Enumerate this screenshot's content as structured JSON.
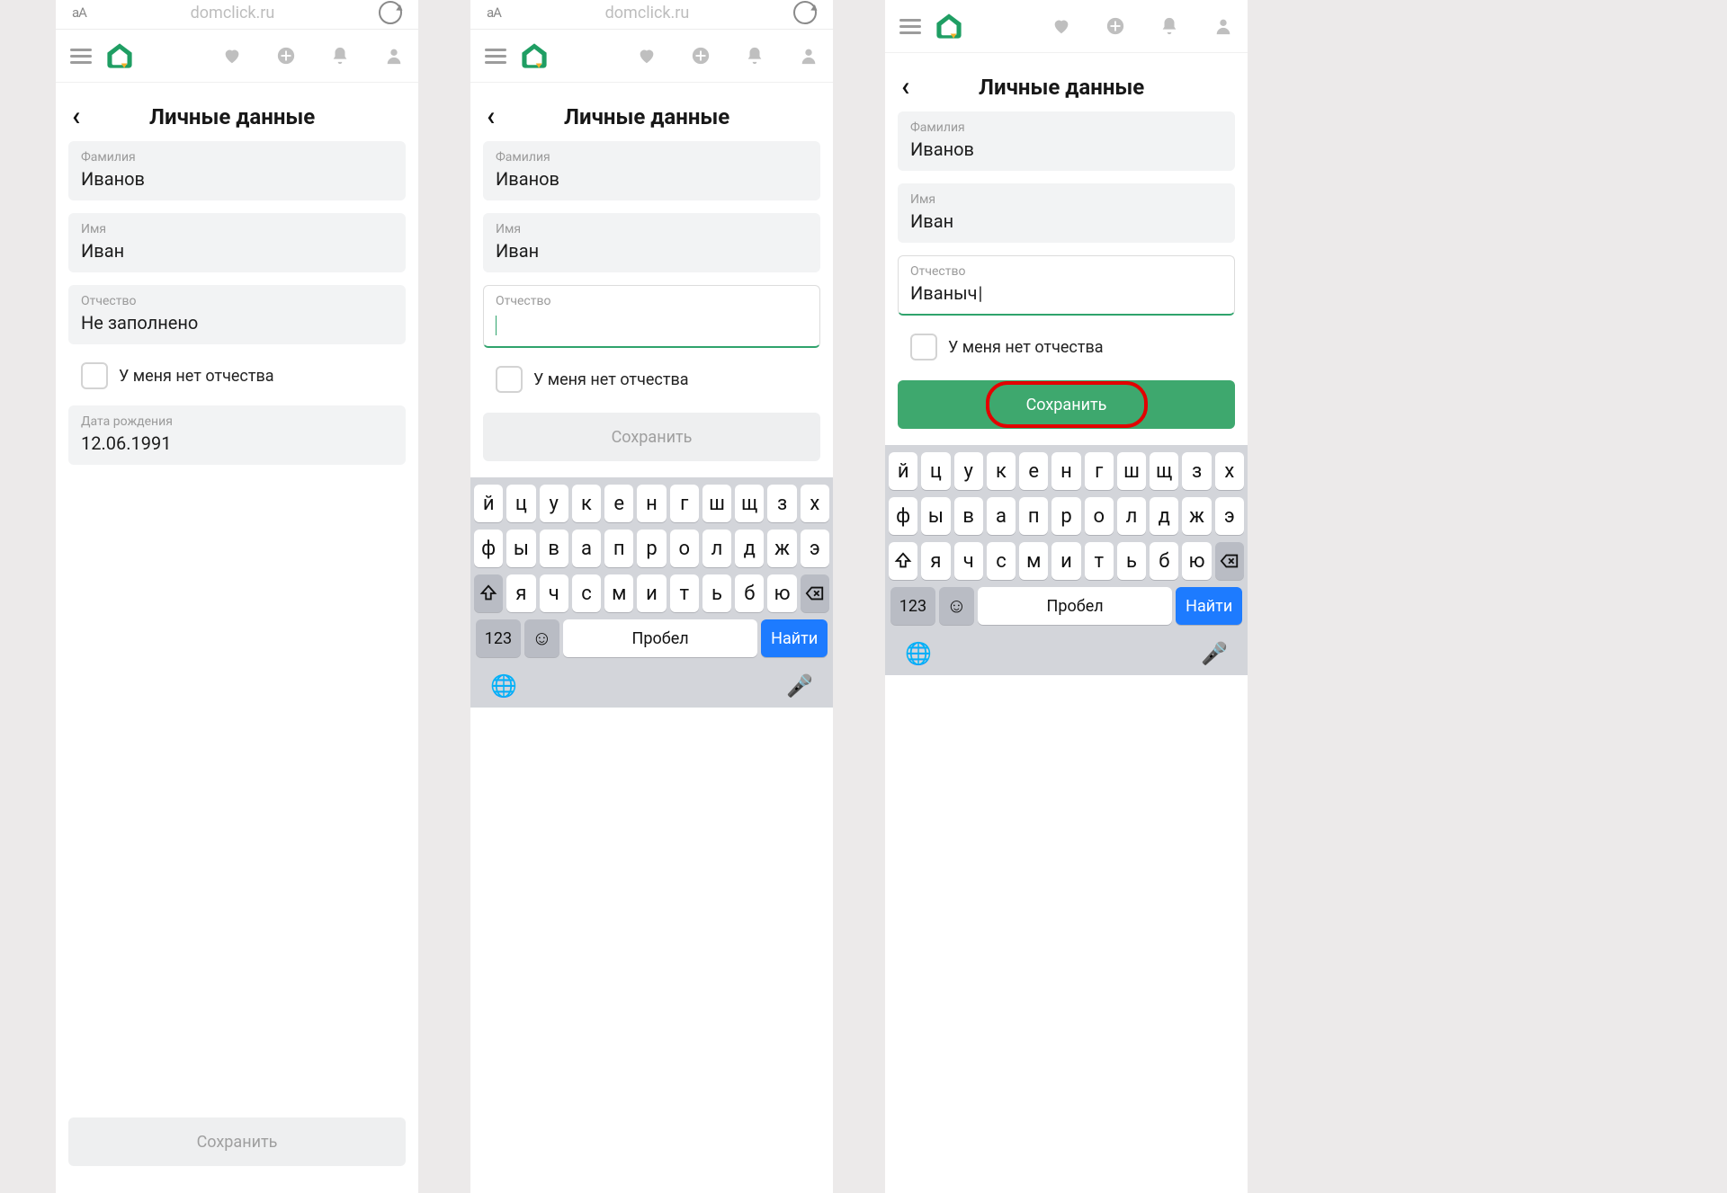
{
  "meta": {
    "site": "domclick.ru"
  },
  "header": {
    "icons": [
      "heart",
      "plus",
      "bell",
      "user"
    ]
  },
  "page": {
    "title": "Личные данные"
  },
  "labels": {
    "surname": "Фамилия",
    "name": "Имя",
    "patronymic": "Отчество",
    "birthdate": "Дата рождения",
    "no_patronymic": "У меня нет отчества",
    "save": "Сохранить"
  },
  "screens": [
    {
      "surname": "Иванов",
      "name": "Иван",
      "patronymic": "Не заполнено",
      "patronymic_active": false,
      "birthdate": "12.06.1991",
      "save_enabled": false,
      "show_keyboard": false,
      "save_highlight": false
    },
    {
      "surname": "Иванов",
      "name": "Иван",
      "patronymic": "",
      "patronymic_active": true,
      "birthdate": "",
      "save_enabled": false,
      "show_keyboard": true,
      "save_highlight": false
    },
    {
      "surname": "Иванов",
      "name": "Иван",
      "patronymic": "Иваныч",
      "patronymic_active": true,
      "birthdate": "",
      "save_enabled": true,
      "show_keyboard": true,
      "save_highlight": true
    }
  ],
  "keyboard": {
    "row1": [
      "й",
      "ц",
      "у",
      "к",
      "е",
      "н",
      "г",
      "ш",
      "щ",
      "з",
      "х"
    ],
    "row2": [
      "ф",
      "ы",
      "в",
      "а",
      "п",
      "р",
      "о",
      "л",
      "д",
      "ж",
      "э"
    ],
    "row3": [
      "я",
      "ч",
      "с",
      "м",
      "и",
      "т",
      "ь",
      "б",
      "ю"
    ],
    "numkey": "123",
    "space": "Пробел",
    "find": "Найти"
  }
}
